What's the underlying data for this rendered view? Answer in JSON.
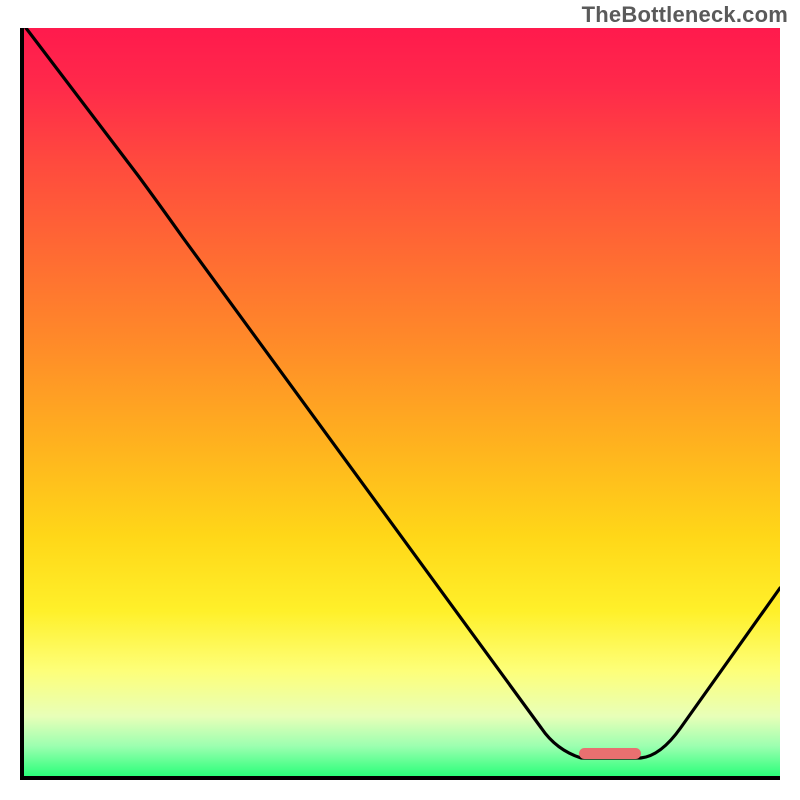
{
  "watermark": "TheBottleneck.com",
  "chart_data": {
    "type": "line",
    "title": "",
    "xlabel": "",
    "ylabel": "",
    "xlim": [
      0,
      100
    ],
    "ylim": [
      0,
      100
    ],
    "grid": false,
    "legend": false,
    "series": [
      {
        "name": "bottleneck-curve",
        "x": [
          0,
          15,
          21,
          68,
          74,
          82,
          87,
          100
        ],
        "y": [
          100,
          80,
          72,
          6,
          2,
          2,
          6,
          25
        ]
      }
    ],
    "annotations": [
      {
        "name": "optimal-marker",
        "shape": "pill",
        "x_range": [
          73,
          81
        ],
        "y": 2,
        "color": "#e87070"
      }
    ],
    "background_gradient": {
      "direction": "vertical",
      "stops": [
        {
          "pos": 0.0,
          "color": "#ff1a4d"
        },
        {
          "pos": 0.3,
          "color": "#ff6a33"
        },
        {
          "pos": 0.68,
          "color": "#ffd718"
        },
        {
          "pos": 0.86,
          "color": "#fdff7a"
        },
        {
          "pos": 1.0,
          "color": "#2bff7a"
        }
      ]
    },
    "axes": {
      "left": {
        "visible": true,
        "ticks": []
      },
      "bottom": {
        "visible": true,
        "ticks": []
      }
    }
  },
  "colors": {
    "axis": "#000000",
    "curve": "#000000",
    "marker": "#e87070",
    "watermark": "#5a5a5a"
  }
}
